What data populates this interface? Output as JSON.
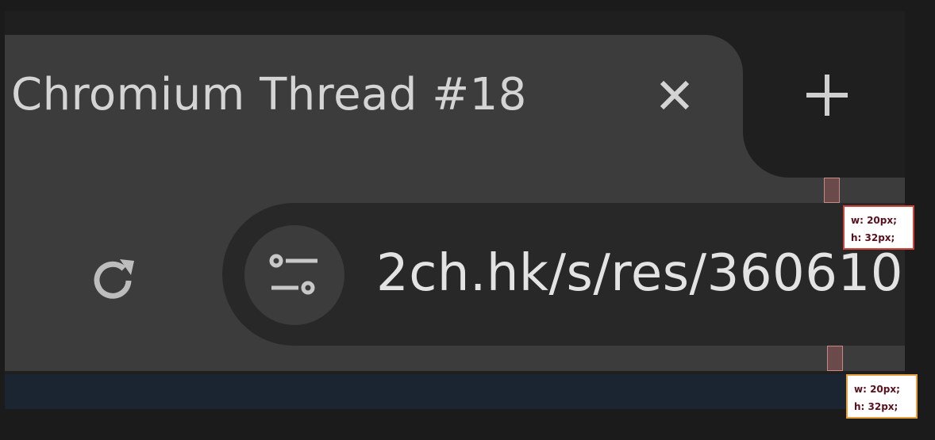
{
  "tab": {
    "title": "Chromium Thread #18",
    "close_icon": "close-icon",
    "new_tab_icon": "plus-icon"
  },
  "toolbar": {
    "reload_icon": "reload-icon",
    "site_info_icon": "tune-icon",
    "url": "2ch.hk/s/res/360610"
  },
  "overlay": {
    "badges": [
      {
        "width": "w: 20px;",
        "height": "h: 32px;"
      },
      {
        "width": "w: 20px;",
        "height": "h: 32px;"
      }
    ]
  },
  "colors": {
    "frame": "#1f1f1f",
    "tab": "#3c3c3c",
    "omnibox": "#282828",
    "text": "#d4d4d4",
    "page": "#1b2532",
    "badge_border_red": "#d0443c",
    "badge_border_orange": "#e8a040"
  }
}
